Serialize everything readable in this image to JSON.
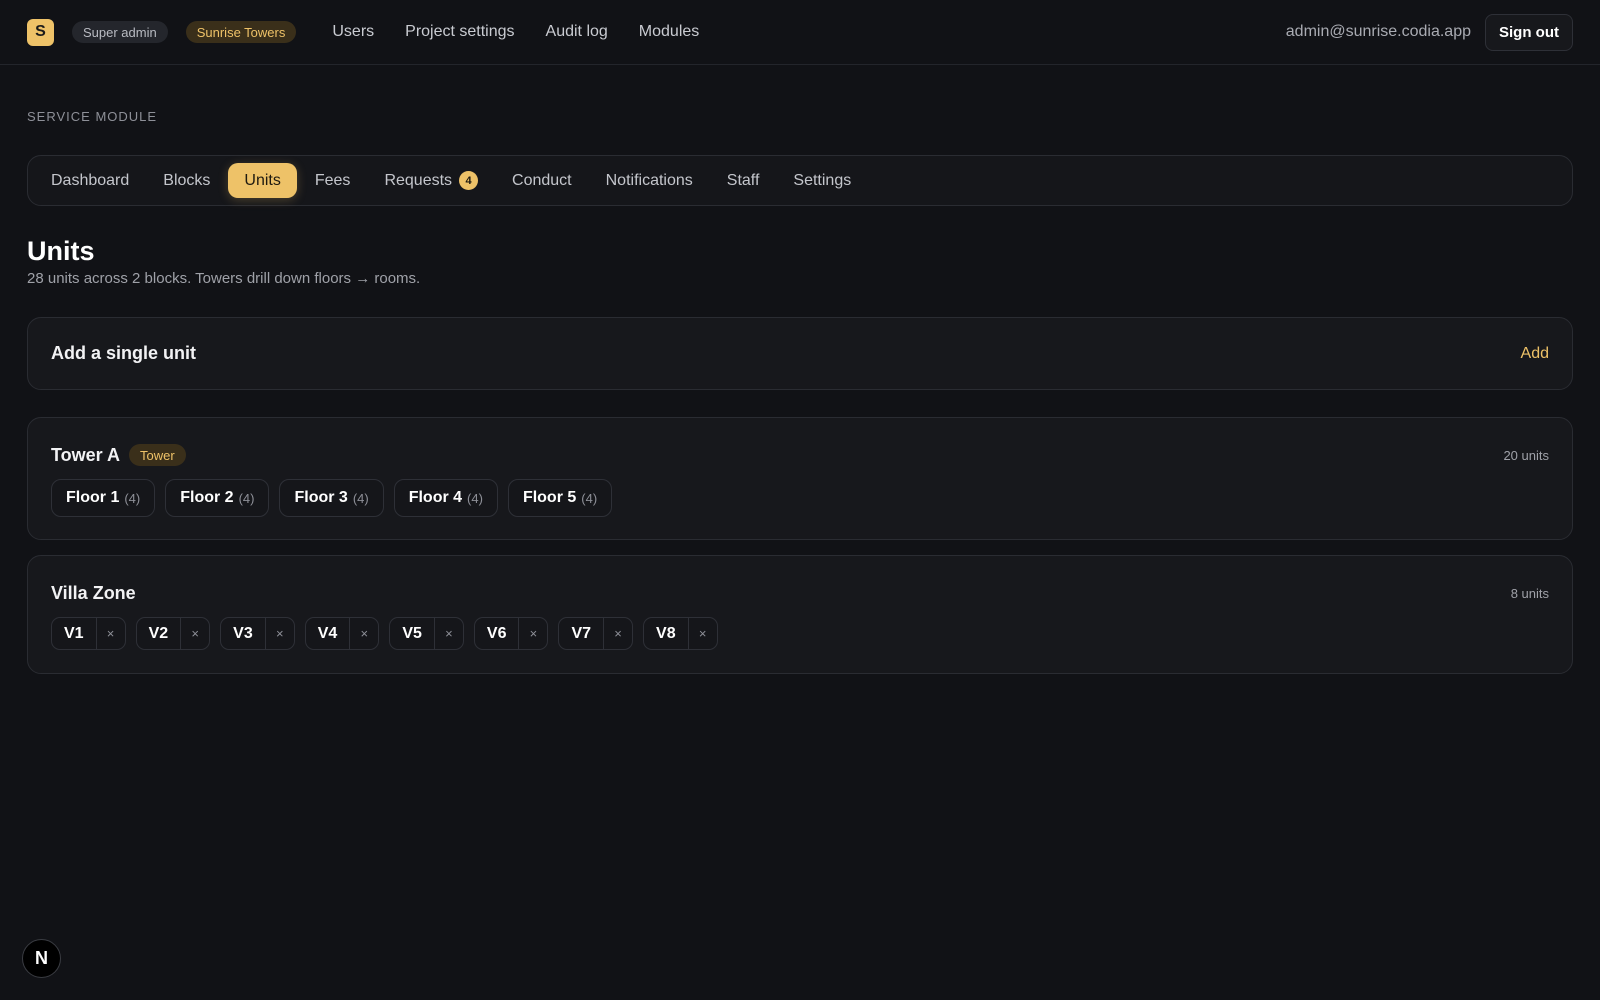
{
  "header": {
    "logo_letter": "S",
    "role_badge": "Super admin",
    "project_badge": "Sunrise Towers",
    "nav": [
      "Users",
      "Project settings",
      "Audit log",
      "Modules"
    ],
    "user_email": "admin@sunrise.codia.app",
    "sign_out_label": "Sign out"
  },
  "module": {
    "section_label": "SERVICE MODULE",
    "tabs": [
      {
        "label": "Dashboard"
      },
      {
        "label": "Blocks"
      },
      {
        "label": "Units",
        "active": true
      },
      {
        "label": "Fees"
      },
      {
        "label": "Requests",
        "badge": "4"
      },
      {
        "label": "Conduct"
      },
      {
        "label": "Notifications"
      },
      {
        "label": "Staff"
      },
      {
        "label": "Settings"
      }
    ]
  },
  "page": {
    "title": "Units",
    "subtitle": "28 units across 2 blocks. Towers drill down floors → rooms."
  },
  "add_unit": {
    "title": "Add a single unit",
    "action_label": "Add"
  },
  "blocks": [
    {
      "name": "Tower A",
      "tag": "Tower",
      "count_label": "20 units",
      "floors": [
        {
          "label": "Floor 1",
          "count": "(4)"
        },
        {
          "label": "Floor 2",
          "count": "(4)"
        },
        {
          "label": "Floor 3",
          "count": "(4)"
        },
        {
          "label": "Floor 4",
          "count": "(4)"
        },
        {
          "label": "Floor 5",
          "count": "(4)"
        }
      ]
    },
    {
      "name": "Villa Zone",
      "count_label": "8 units",
      "units": [
        "V1",
        "V2",
        "V3",
        "V4",
        "V5",
        "V6",
        "V7",
        "V8"
      ],
      "remove_glyph": "×"
    }
  ],
  "dev_indicator": "N",
  "colors": {
    "accent": "#eec268",
    "background": "#111216",
    "card": "#17181c"
  }
}
